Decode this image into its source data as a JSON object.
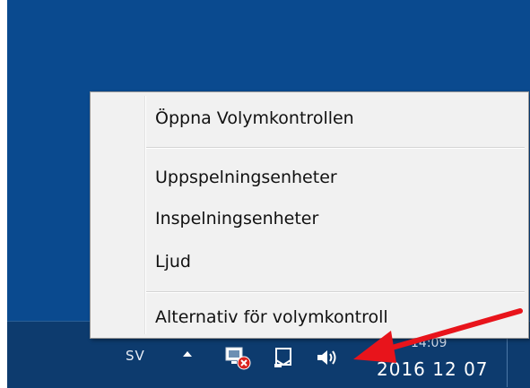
{
  "menu": {
    "items": [
      {
        "label": "Öppna Volymkontrollen"
      },
      {
        "label": "Uppspelningsenheter"
      },
      {
        "label": "Inspelningsenheter"
      },
      {
        "label": "Ljud"
      },
      {
        "label": "Alternativ för volymkontroll"
      }
    ]
  },
  "taskbar": {
    "language": "SV",
    "time": "14:09",
    "date": "2016 12 07"
  },
  "icons": {
    "show_hidden": "chevron-up-icon",
    "network": "network-error-icon",
    "action_center": "action-center-icon",
    "volume": "speaker-icon"
  },
  "colors": {
    "desktop": "#0a4a8f",
    "taskbar": "#0d3b6e",
    "menu_bg": "#f1f1f1",
    "arrow": "#e8141b"
  }
}
